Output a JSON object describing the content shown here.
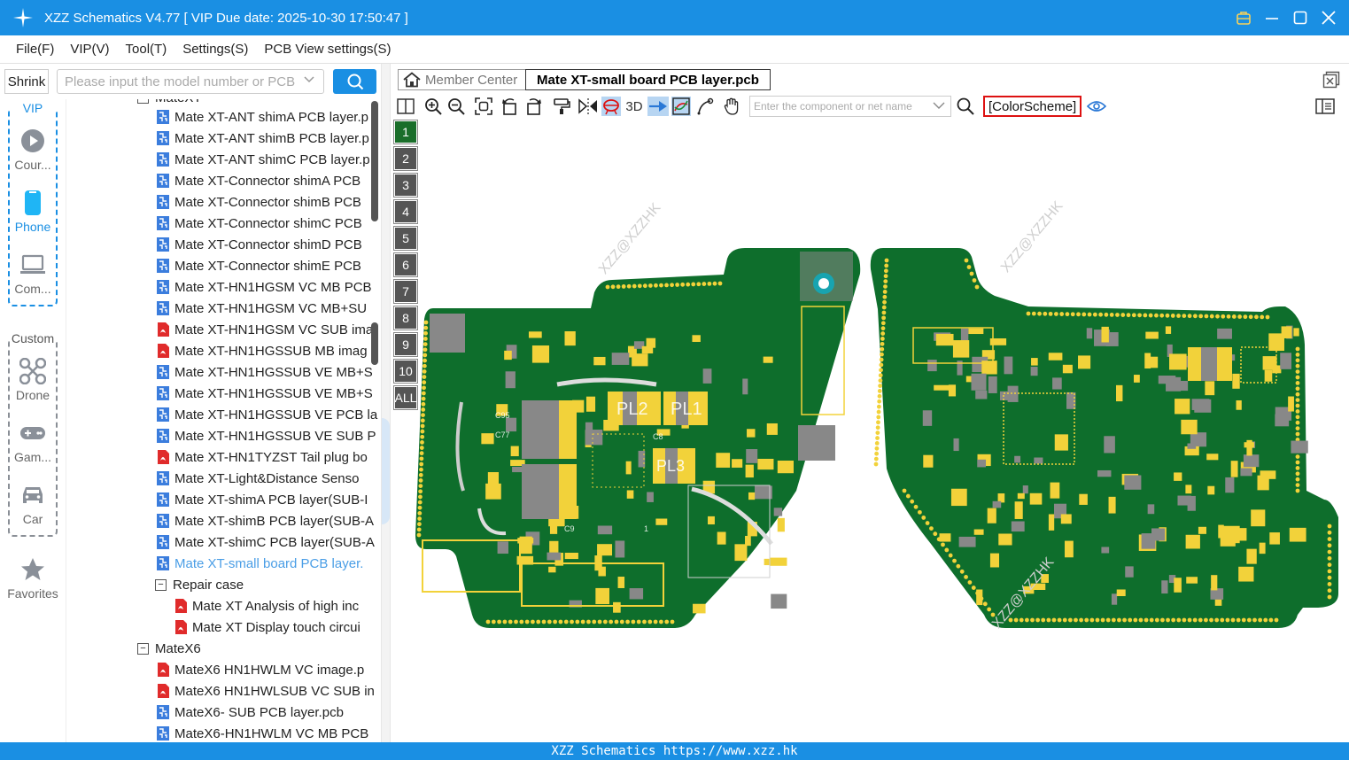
{
  "app": {
    "title": "XZZ Schematics V4.77 [ VIP Due date: 2025-10-30 17:50:47 ]"
  },
  "menu": [
    "File(F)",
    "VIP(V)",
    "Tool(T)",
    "Settings(S)",
    "PCB View settings(S)"
  ],
  "sidebar": {
    "shrink_label": "Shrink",
    "search_placeholder": "Please input the model number or PCB",
    "vip_label": "VIP",
    "custom_label": "Custom",
    "favorites_label": "Favorites",
    "categories": [
      {
        "label": "Cour...",
        "icon": "play-icon"
      },
      {
        "label": "Phone",
        "icon": "phone-icon",
        "active": true
      },
      {
        "label": "Com...",
        "icon": "laptop-icon"
      },
      {
        "label": "Drone",
        "icon": "drone-icon"
      },
      {
        "label": "Gam...",
        "icon": "gamepad-icon"
      },
      {
        "label": "Car",
        "icon": "car-icon"
      }
    ]
  },
  "tree": {
    "top_partial": "MateXT",
    "items": [
      {
        "label": "Mate XT-ANT shimA PCB layer.p",
        "type": "pcb"
      },
      {
        "label": "Mate XT-ANT shimB PCB layer.p",
        "type": "pcb"
      },
      {
        "label": "Mate XT-ANT shimC PCB layer.p",
        "type": "pcb"
      },
      {
        "label": "Mate XT-Connector shimA PCB",
        "type": "pcb"
      },
      {
        "label": "Mate XT-Connector shimB PCB",
        "type": "pcb"
      },
      {
        "label": "Mate XT-Connector shimC PCB",
        "type": "pcb"
      },
      {
        "label": "Mate XT-Connector shimD PCB",
        "type": "pcb"
      },
      {
        "label": "Mate XT-Connector shimE PCB",
        "type": "pcb"
      },
      {
        "label": "Mate XT-HN1HGSM VC MB PCB",
        "type": "pcb"
      },
      {
        "label": "Mate XT-HN1HGSM VC MB+SU",
        "type": "pcb"
      },
      {
        "label": "Mate XT-HN1HGSM VC SUB ima",
        "type": "pdf"
      },
      {
        "label": "Mate XT-HN1HGSSUB MB imag",
        "type": "pdf"
      },
      {
        "label": "Mate XT-HN1HGSSUB VE MB+S",
        "type": "pcb"
      },
      {
        "label": "Mate XT-HN1HGSSUB VE MB+S",
        "type": "pcb"
      },
      {
        "label": "Mate XT-HN1HGSSUB VE PCB la",
        "type": "pcb"
      },
      {
        "label": "Mate XT-HN1HGSSUB VE SUB P",
        "type": "pcb"
      },
      {
        "label": "Mate XT-HN1TYZST Tail plug bo",
        "type": "pdf"
      },
      {
        "label": "Mate XT-Light&Distance Senso",
        "type": "pcb"
      },
      {
        "label": "Mate XT-shimA PCB layer(SUB-I",
        "type": "pcb"
      },
      {
        "label": "Mate XT-shimB PCB layer(SUB-A",
        "type": "pcb"
      },
      {
        "label": "Mate XT-shimC PCB layer(SUB-A",
        "type": "pcb"
      },
      {
        "label": "Mate XT-small board PCB layer.",
        "type": "pcb",
        "selected": true
      }
    ],
    "repair_folder": "Repair case",
    "repair_items": [
      {
        "label": "Mate XT Analysis of high inc",
        "type": "pdf"
      },
      {
        "label": "Mate XT Display touch circui",
        "type": "pdf"
      }
    ],
    "folder2": "MateX6",
    "folder2_items": [
      {
        "label": "MateX6 HN1HWLM VC image.p",
        "type": "pdf"
      },
      {
        "label": "MateX6 HN1HWLSUB VC SUB in",
        "type": "pdf"
      },
      {
        "label": "MateX6- SUB PCB layer.pcb",
        "type": "pcb"
      },
      {
        "label": "MateX6-HN1HWLM VC MB PCB",
        "type": "pcb"
      }
    ]
  },
  "tabs": {
    "home": "Member Center",
    "active": "Mate XT-small board PCB layer.pcb"
  },
  "viewer": {
    "label_3d": "3D",
    "component_placeholder": "Enter the component or net name",
    "colorscheme": "[ColorScheme]",
    "layers": [
      "1",
      "2",
      "3",
      "4",
      "5",
      "6",
      "7",
      "8",
      "9",
      "10",
      "ALL"
    ],
    "active_layer": "1",
    "board_labels": [
      "PL2",
      "PL1",
      "PL3",
      "C95",
      "C77",
      "C8",
      "C9",
      "1"
    ],
    "watermark": "XZZ@XZZHK",
    "colors": {
      "board": "#0e6e2c",
      "pad": "#f2d23a",
      "component": "#888888"
    }
  },
  "status": {
    "text": "XZZ Schematics https://www.xzz.hk"
  }
}
